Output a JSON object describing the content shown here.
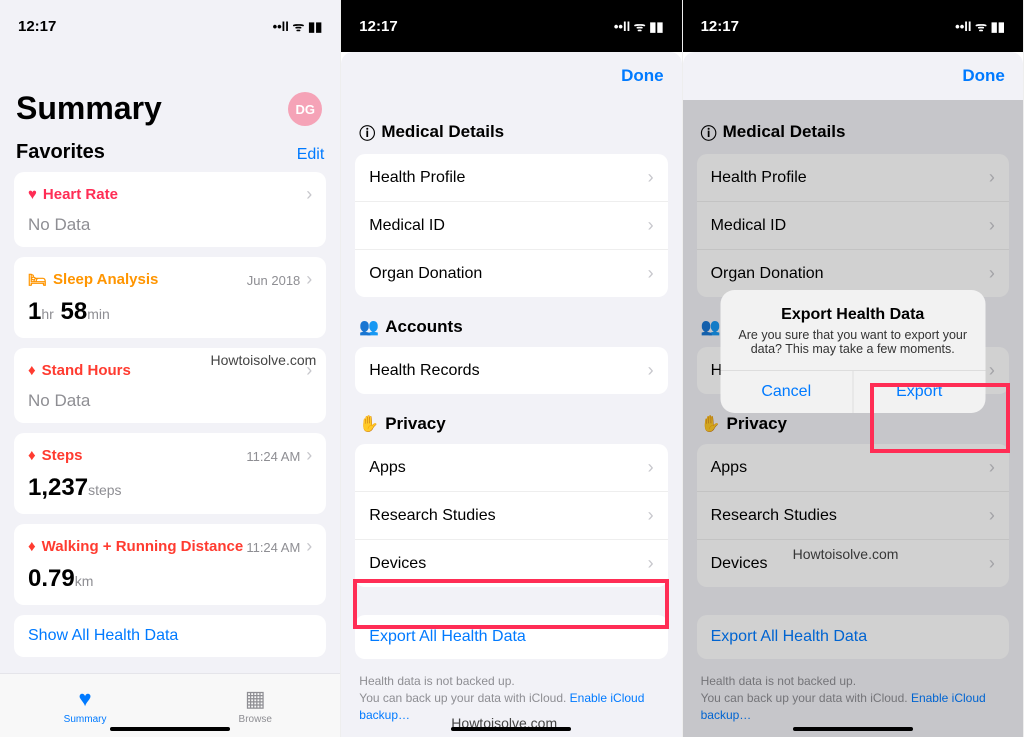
{
  "status": {
    "time": "12:17",
    "icons": "••ll ᯤ ▮▮"
  },
  "watermark": "Howtoisolve.com",
  "screen1": {
    "title": "Summary",
    "avatar": "DG",
    "favorites": "Favorites",
    "edit": "Edit",
    "cards": {
      "heart": {
        "label": "Heart Rate",
        "body": "No Data"
      },
      "sleep": {
        "label": "Sleep Analysis",
        "sub": "Jun 2018",
        "big_num1": "1",
        "big_u1": "hr",
        "big_num2": "58",
        "big_u2": "min"
      },
      "stand": {
        "label": "Stand Hours",
        "body": "No Data"
      },
      "steps": {
        "label": "Steps",
        "sub": "11:24 AM",
        "big_num": "1,237",
        "big_u": "steps"
      },
      "walk": {
        "label": "Walking + Running Distance",
        "sub": "11:24 AM",
        "big_num": "0.79",
        "big_u": "km"
      }
    },
    "showall": "Show All Health Data",
    "tabs": {
      "summary": "Summary",
      "browse": "Browse"
    }
  },
  "settings": {
    "done": "Done",
    "sections": {
      "med": {
        "title": "Medical Details",
        "rows": [
          "Health Profile",
          "Medical ID",
          "Organ Donation"
        ]
      },
      "acc": {
        "title": "Accounts",
        "rows": [
          "Health Records"
        ]
      },
      "priv": {
        "title": "Privacy",
        "rows": [
          "Apps",
          "Research Studies",
          "Devices"
        ]
      }
    },
    "export": "Export All Health Data",
    "footer1": "Health data is not backed up.",
    "footer2": "You can back up your data with iCloud. ",
    "footer_link": "Enable iCloud backup…"
  },
  "alert": {
    "title": "Export Health Data",
    "message": "Are you sure that you want to export your data? This may take a few moments.",
    "cancel": "Cancel",
    "export": "Export"
  }
}
